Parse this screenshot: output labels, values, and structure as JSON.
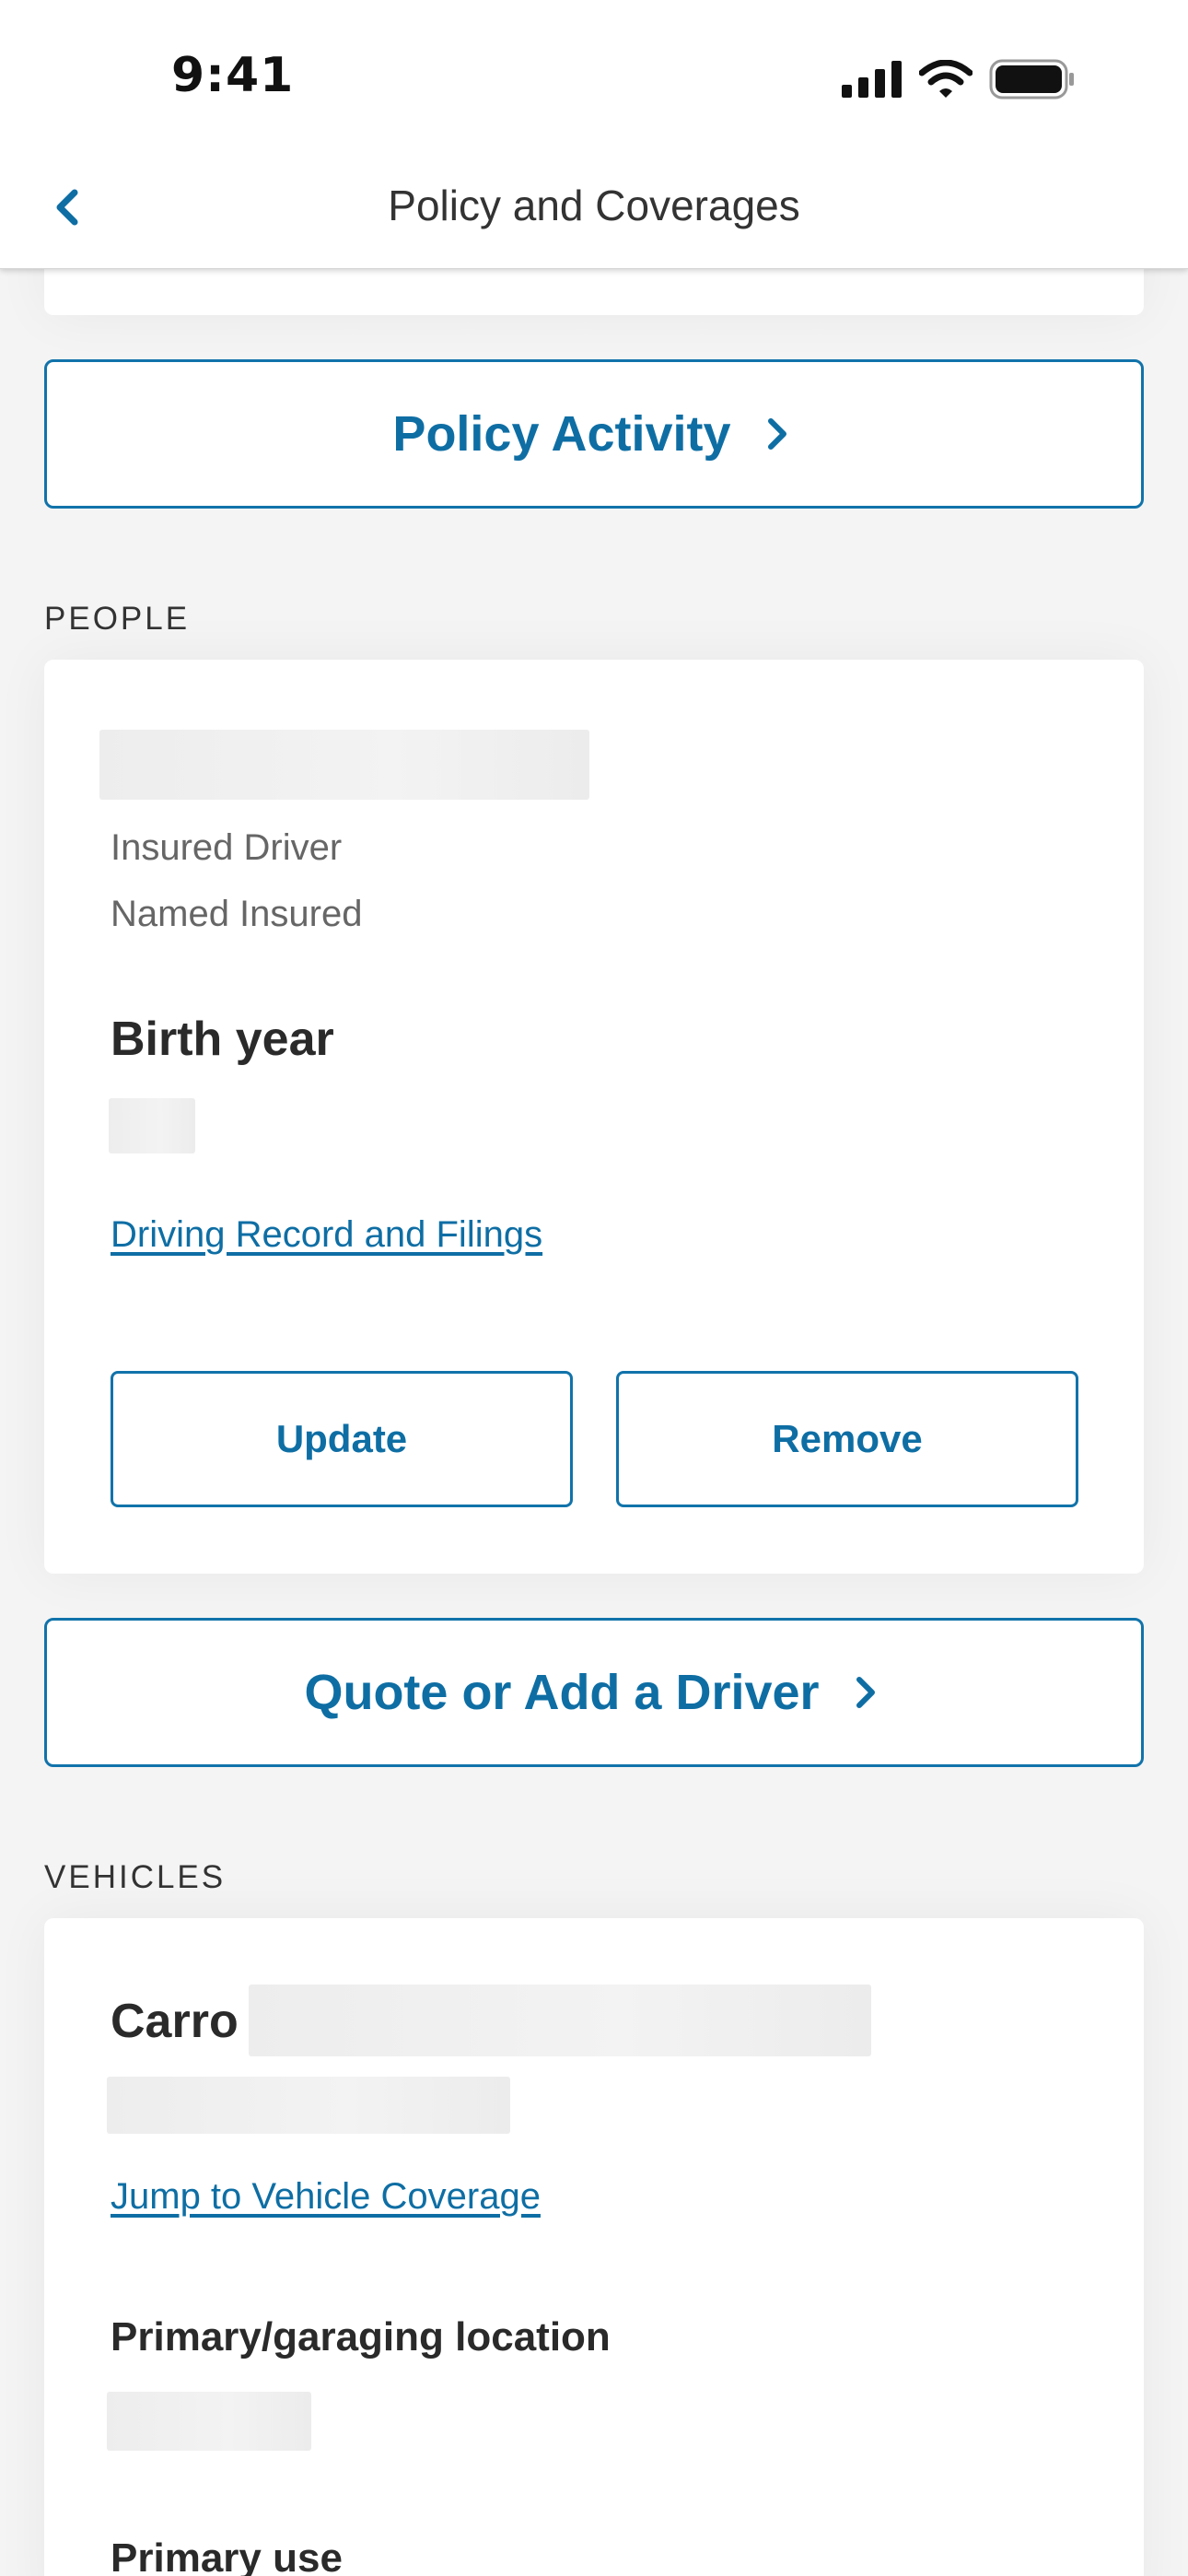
{
  "status_bar": {
    "time": "9:41"
  },
  "nav": {
    "title": "Policy and Coverages"
  },
  "policy_activity": {
    "label": "Policy Activity"
  },
  "people": {
    "section_label": "PEOPLE",
    "roles": [
      "Insured Driver",
      "Named Insured"
    ],
    "birth_year_label": "Birth year",
    "driving_record_link": "Driving Record and Filings",
    "update_label": "Update",
    "remove_label": "Remove"
  },
  "quote_driver": {
    "label": "Quote or Add a Driver"
  },
  "vehicles": {
    "section_label": "VEHICLES",
    "vehicle_name_prefix": "Carro",
    "jump_link": "Jump to Vehicle Coverage",
    "garaging_label": "Primary/garaging location",
    "primary_use_label": "Primary use"
  },
  "colors": {
    "accent": "#0e6ea4",
    "background": "#f4f4f4",
    "card": "#ffffff"
  }
}
